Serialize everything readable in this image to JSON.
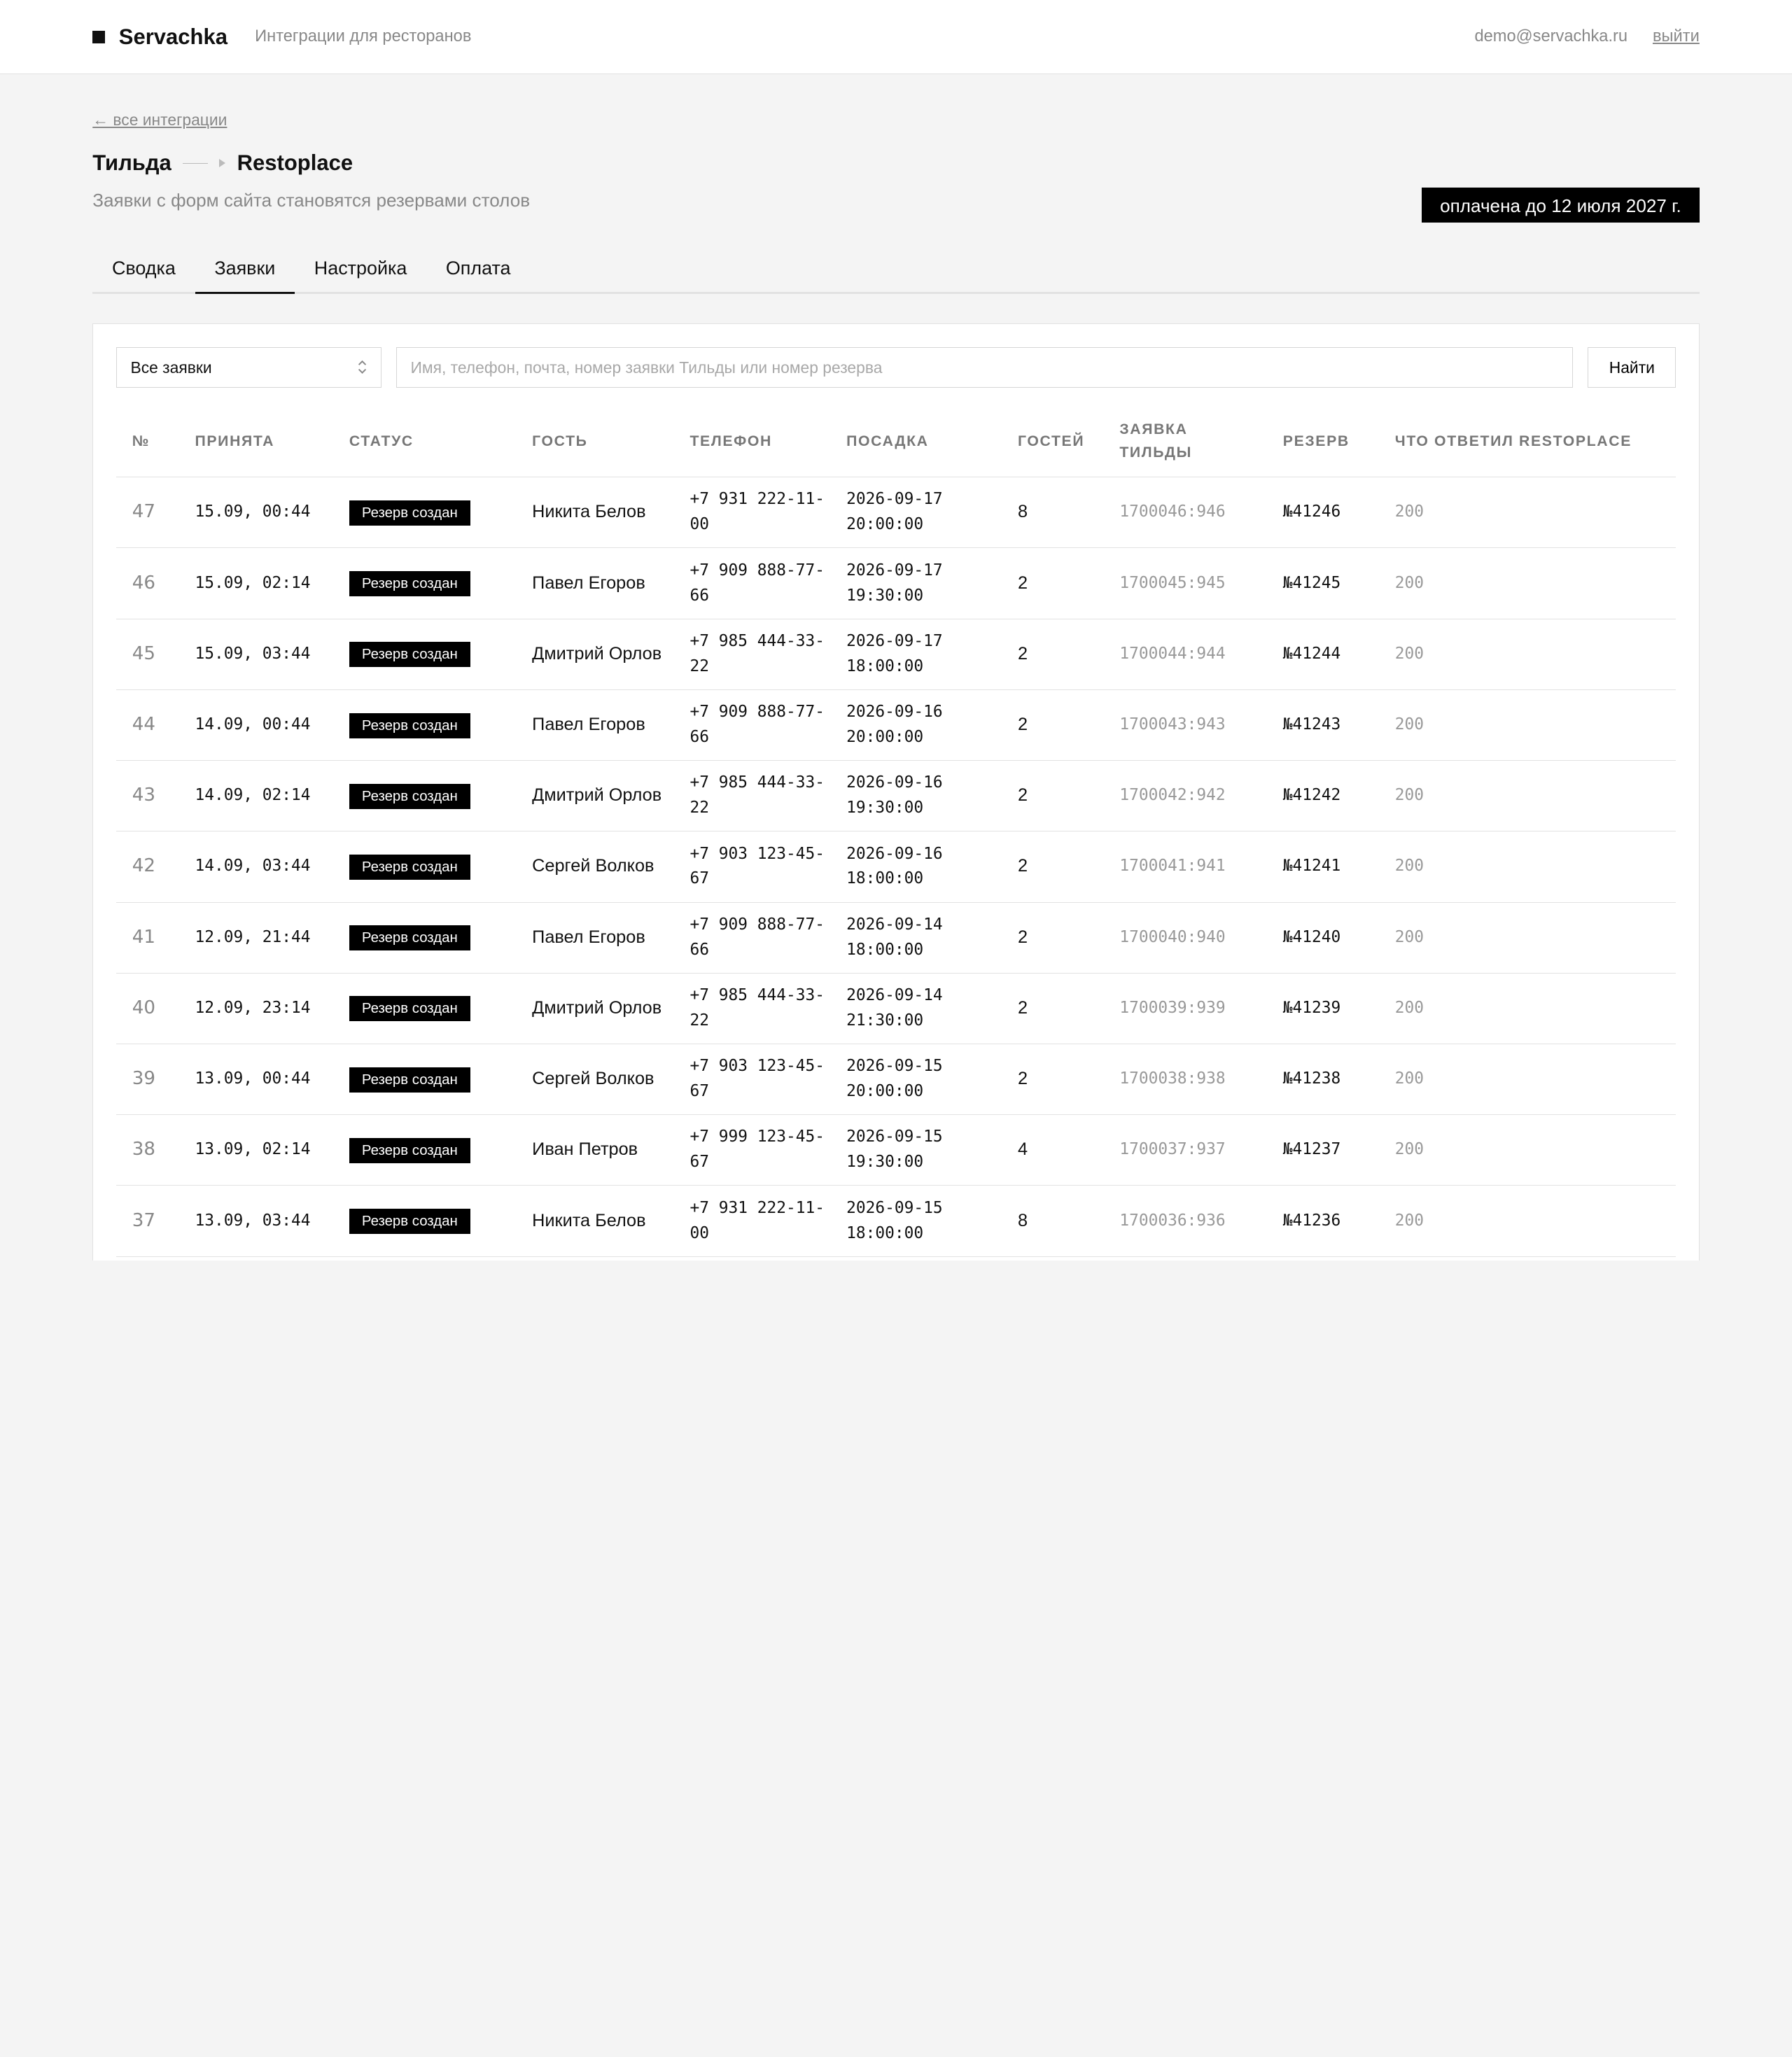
{
  "header": {
    "logo": "Servachka",
    "tagline": "Интеграции для ресторанов",
    "user_email": "demo@servachka.ru",
    "logout": "выйти"
  },
  "page": {
    "back_link": "← все интеграции",
    "crumb_from": "Тильда",
    "crumb_to": "Restoplace",
    "subtitle": "Заявки с форм сайта становятся резервами столов",
    "paid_badge": "оплачена до 12 июля 2027 г."
  },
  "tabs": [
    {
      "label": "Сводка",
      "active": false
    },
    {
      "label": "Заявки",
      "active": true
    },
    {
      "label": "Настройка",
      "active": false
    },
    {
      "label": "Оплата",
      "active": false
    }
  ],
  "filters": {
    "select_value": "Все заявки",
    "search_placeholder": "Имя, телефон, почта, номер заявки Тильды или номер резерва",
    "search_value": "",
    "find_button": "Найти"
  },
  "table": {
    "columns": [
      "№",
      "Принята",
      "Статус",
      "Гость",
      "Телефон",
      "Посадка",
      "Гостей",
      "Заявка Тильды",
      "Резерв",
      "Что ответил Restoplace"
    ],
    "rows": [
      {
        "num": "47",
        "accepted": "15.09, 00:44",
        "status": "Резерв создан",
        "guest": "Никита Белов",
        "phone": "+7 931 222-11-00",
        "seating": "2026-09-17 20:00:00",
        "guests": "8",
        "tilda": "1700046:946",
        "reserve": "№41246",
        "reply": "200"
      },
      {
        "num": "46",
        "accepted": "15.09, 02:14",
        "status": "Резерв создан",
        "guest": "Павел Егоров",
        "phone": "+7 909 888-77-66",
        "seating": "2026-09-17 19:30:00",
        "guests": "2",
        "tilda": "1700045:945",
        "reserve": "№41245",
        "reply": "200"
      },
      {
        "num": "45",
        "accepted": "15.09, 03:44",
        "status": "Резерв создан",
        "guest": "Дмитрий Орлов",
        "phone": "+7 985 444-33-22",
        "seating": "2026-09-17 18:00:00",
        "guests": "2",
        "tilda": "1700044:944",
        "reserve": "№41244",
        "reply": "200"
      },
      {
        "num": "44",
        "accepted": "14.09, 00:44",
        "status": "Резерв создан",
        "guest": "Павел Егоров",
        "phone": "+7 909 888-77-66",
        "seating": "2026-09-16 20:00:00",
        "guests": "2",
        "tilda": "1700043:943",
        "reserve": "№41243",
        "reply": "200"
      },
      {
        "num": "43",
        "accepted": "14.09, 02:14",
        "status": "Резерв создан",
        "guest": "Дмитрий Орлов",
        "phone": "+7 985 444-33-22",
        "seating": "2026-09-16 19:30:00",
        "guests": "2",
        "tilda": "1700042:942",
        "reserve": "№41242",
        "reply": "200"
      },
      {
        "num": "42",
        "accepted": "14.09, 03:44",
        "status": "Резерв создан",
        "guest": "Сергей Волков",
        "phone": "+7 903 123-45-67",
        "seating": "2026-09-16 18:00:00",
        "guests": "2",
        "tilda": "1700041:941",
        "reserve": "№41241",
        "reply": "200"
      },
      {
        "num": "41",
        "accepted": "12.09, 21:44",
        "status": "Резерв создан",
        "guest": "Павел Егоров",
        "phone": "+7 909 888-77-66",
        "seating": "2026-09-14 18:00:00",
        "guests": "2",
        "tilda": "1700040:940",
        "reserve": "№41240",
        "reply": "200"
      },
      {
        "num": "40",
        "accepted": "12.09, 23:14",
        "status": "Резерв создан",
        "guest": "Дмитрий Орлов",
        "phone": "+7 985 444-33-22",
        "seating": "2026-09-14 21:30:00",
        "guests": "2",
        "tilda": "1700039:939",
        "reserve": "№41239",
        "reply": "200"
      },
      {
        "num": "39",
        "accepted": "13.09, 00:44",
        "status": "Резерв создан",
        "guest": "Сергей Волков",
        "phone": "+7 903 123-45-67",
        "seating": "2026-09-15 20:00:00",
        "guests": "2",
        "tilda": "1700038:938",
        "reserve": "№41238",
        "reply": "200"
      },
      {
        "num": "38",
        "accepted": "13.09, 02:14",
        "status": "Резерв создан",
        "guest": "Иван Петров",
        "phone": "+7 999 123-45-67",
        "seating": "2026-09-15 19:30:00",
        "guests": "4",
        "tilda": "1700037:937",
        "reserve": "№41237",
        "reply": "200"
      },
      {
        "num": "37",
        "accepted": "13.09, 03:44",
        "status": "Резерв создан",
        "guest": "Никита Белов",
        "phone": "+7 931 222-11-00",
        "seating": "2026-09-15 18:00:00",
        "guests": "8",
        "tilda": "1700036:936",
        "reserve": "№41236",
        "reply": "200"
      }
    ]
  }
}
